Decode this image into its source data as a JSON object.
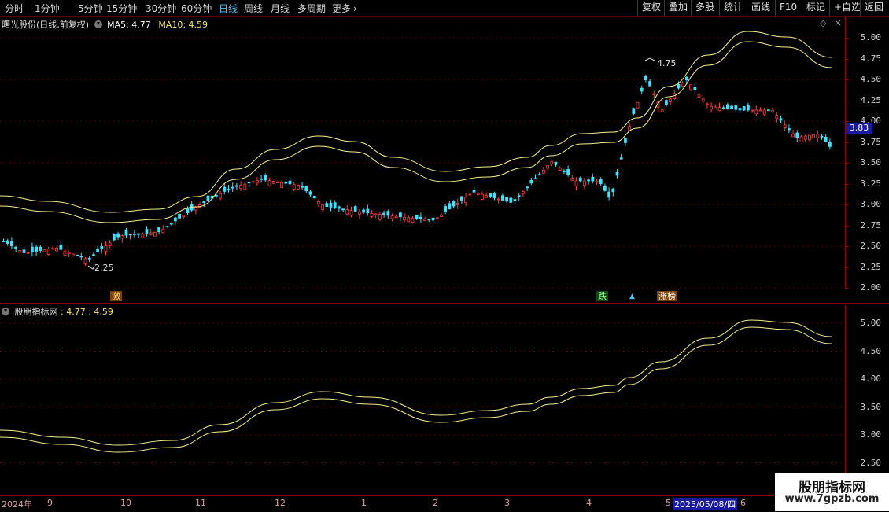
{
  "toolbar": {
    "periods": [
      "分时",
      "1分钟",
      "5分钟",
      "15分钟",
      "30分钟",
      "60分钟",
      "日线",
      "周线",
      "月线",
      "多周期",
      "更多"
    ],
    "active_period": "日线",
    "right_buttons": [
      "复权",
      "叠加",
      "多股",
      "统计",
      "画线",
      "F10",
      "标记",
      "+自选",
      "返回"
    ]
  },
  "main_panel": {
    "title": "曙光股份(日线,前复权)",
    "ma5_label": "MA5: 4.77",
    "ma10_label": "MA10: 4.59",
    "max_annotation": "4.75",
    "min_annotation": "2.25",
    "current_price": "3.83",
    "price_ticks": [
      "5.00",
      "4.75",
      "4.50",
      "4.25",
      "4.00",
      "3.75",
      "3.50",
      "3.25",
      "3.00",
      "2.75",
      "2.50",
      "2.25",
      "2.00"
    ],
    "signals": [
      {
        "text": "激",
        "color": "#ffd27f",
        "bg": "#7a3f00"
      },
      {
        "text": "跌",
        "color": "#ffffff",
        "bg": "#1f7a1f"
      },
      {
        "text": "涨榜",
        "color": "#ffffff",
        "bg": "#7a3f00"
      }
    ]
  },
  "indicator_panel": {
    "title": "股朋指标网",
    "values": ": 4.77 : 4.59",
    "ticks": [
      "5.00",
      "4.50",
      "4.00",
      "3.50",
      "3.00",
      "2.50"
    ]
  },
  "date_axis": {
    "labels": [
      "2024年",
      "9",
      "10",
      "11",
      "12",
      "1",
      "2",
      "3",
      "4",
      "5",
      "2025/05/08/四",
      "6"
    ]
  },
  "watermark": {
    "title": "股朋指标网",
    "url": "www.7gpzb.com"
  },
  "colors": {
    "up": "#ff3b3b",
    "down": "#40e0ff",
    "band": "#f5f08a",
    "grid": "#5a0000"
  }
}
